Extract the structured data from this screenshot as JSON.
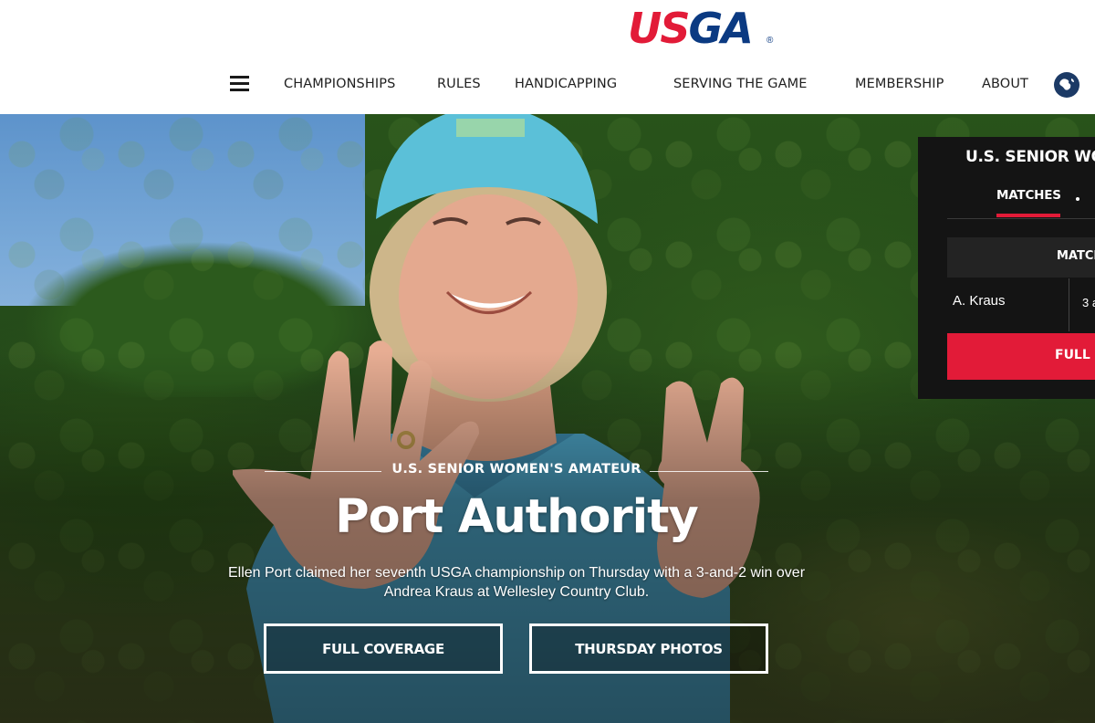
{
  "header": {
    "logo": {
      "text_us": "US",
      "text_ga": "GA",
      "registered": "®"
    },
    "nav": {
      "menu_icon": "hamburger-menu-icon",
      "items": [
        {
          "label": "CHAMPIONSHIPS"
        },
        {
          "label": "RULES"
        },
        {
          "label": "HANDICAPPING"
        },
        {
          "label": "SERVING THE GAME"
        },
        {
          "label": "MEMBERSHIP"
        },
        {
          "label": "ABOUT"
        }
      ],
      "globe_icon": "globe-icon"
    }
  },
  "hero": {
    "eyebrow": "U.S. SENIOR WOMEN'S AMATEUR",
    "headline": "Port Authority",
    "summary": "Ellen Port claimed her seventh USGA championship on Thursday with a 3-and-2 win over Andrea Kraus at Wellesley Country Club.",
    "buttons": [
      {
        "label": "FULL COVERAGE"
      },
      {
        "label": "THURSDAY PHOTOS"
      }
    ]
  },
  "widget": {
    "title": "U.S. SENIOR WO",
    "tab": "MATCHES",
    "match_header": "MATCH",
    "player": "A. Kraus",
    "score": "3 a",
    "button": "FULL S"
  },
  "colors": {
    "brand_red": "#e21b38",
    "brand_blue": "#0b3a82",
    "widget_bg": "#141414"
  }
}
